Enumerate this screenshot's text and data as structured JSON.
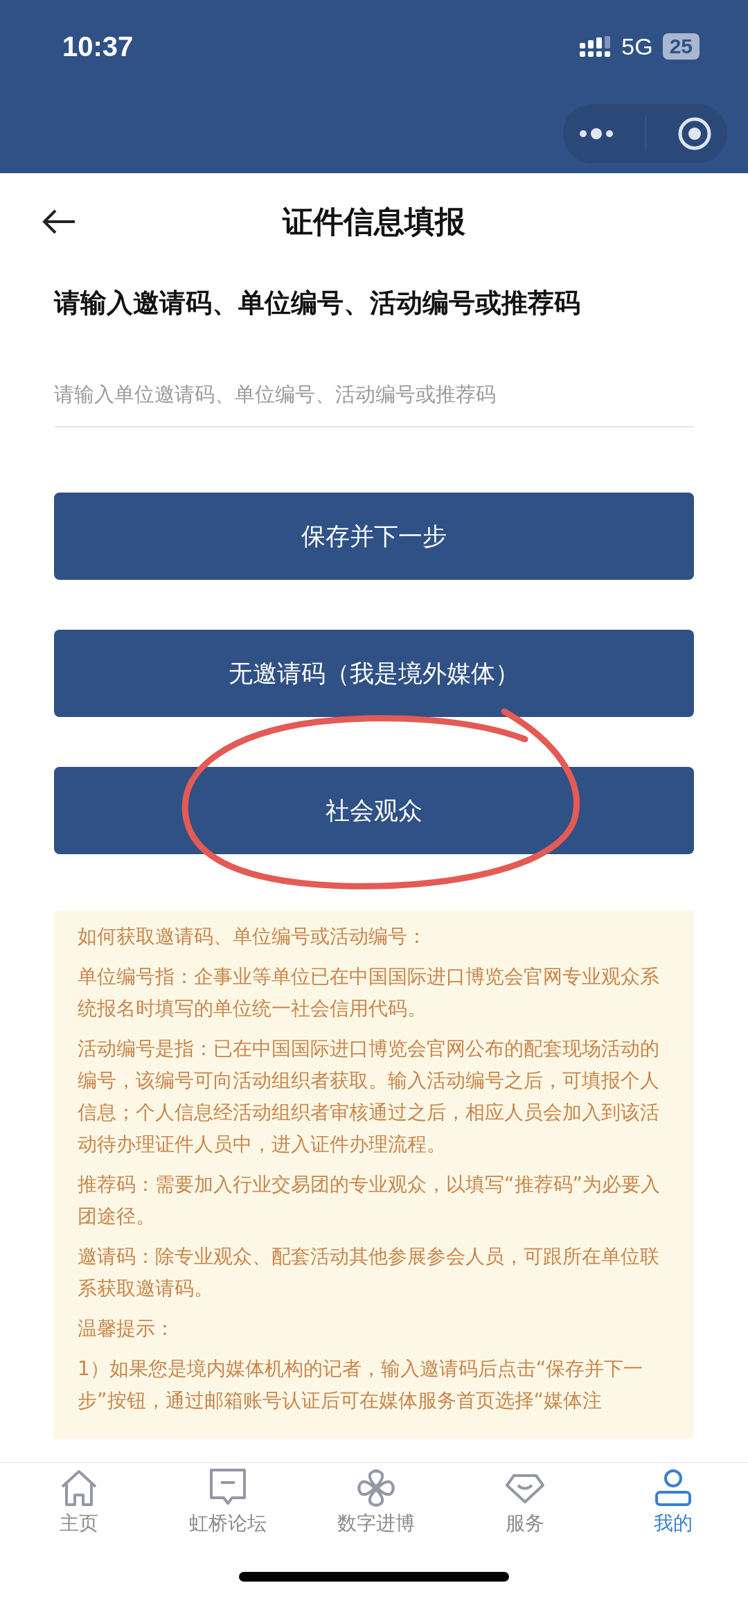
{
  "status_bar": {
    "time": "10:37",
    "network": "5G",
    "battery": "25"
  },
  "header": {
    "title": "证件信息填报"
  },
  "heading": "请输入邀请码、单位编号、活动编号或推荐码",
  "code_field": {
    "placeholder": "请输入单位邀请码、单位编号、活动编号或推荐码"
  },
  "buttons": [
    {
      "label": "保存并下一步",
      "circled": false
    },
    {
      "label": "无邀请码（我是境外媒体）",
      "circled": false
    },
    {
      "label": "社会观众",
      "circled": true
    }
  ],
  "notice": {
    "paragraphs": [
      "如何获取邀请码、单位编号或活动编号：",
      "单位编号指：企事业等单位已在中国国际进口博览会官网专业观众系统报名时填写的单位统一社会信用代码。",
      "活动编号是指：已在中国国际进口博览会官网公布的配套现场活动的编号，该编号可向活动组织者获取。输入活动编号之后，可填报个人信息；个人信息经活动组织者审核通过之后，相应人员会加入到该活动待办理证件人员中，进入证件办理流程。",
      "推荐码：需要加入行业交易团的专业观众，以填写“推荐码”为必要入团途径。",
      "邀请码：除专业观众、配套活动其他参展参会人员，可跟所在单位联系获取邀请码。",
      "温馨提示：",
      "1）如果您是境内媒体机构的记者，输入邀请码后点击“保存并下一步”按钮，通过邮箱账号认证后可在媒体服务首页选择“媒体注"
    ]
  },
  "tab_bar": [
    {
      "label": "主页",
      "kind": "home",
      "selected": false
    },
    {
      "label": "虹桥论坛",
      "kind": "forum",
      "selected": false
    },
    {
      "label": "数字进博",
      "kind": "digital",
      "selected": false
    },
    {
      "label": "服务",
      "kind": "service",
      "selected": false
    },
    {
      "label": "我的",
      "kind": "me",
      "selected": true
    }
  ]
}
